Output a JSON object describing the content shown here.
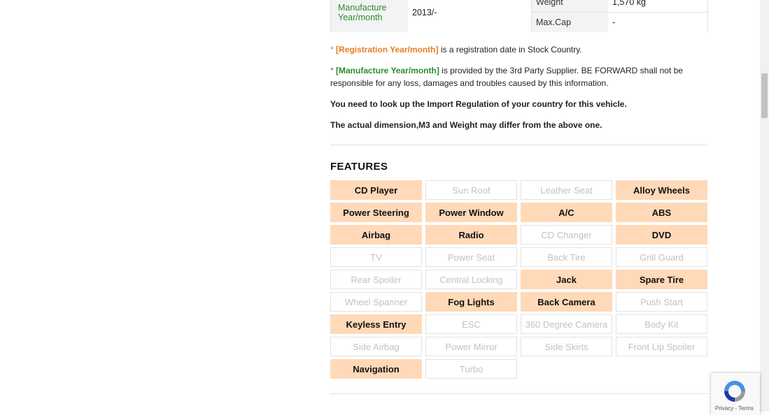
{
  "spec_table": {
    "manufacture_label": "Manufacture Year/month",
    "manufacture_value": "2013/-",
    "weight_label": "Weight",
    "weight_value": "1,570 kg",
    "maxcap_label": "Max.Cap",
    "maxcap_value": "-"
  },
  "notes": {
    "reg_star": "* ",
    "reg_label": "[Registration Year/month]",
    "reg_text": " is a registration date in Stock Country.",
    "man_star": "* ",
    "man_label": "[Manufacture Year/month]",
    "man_text": " is provided by the 3rd Party Supplier. BE FORWARD shall not be responsible for any loss, damages and troubles caused by this information.",
    "import_note": "You need to look up the Import Regulation of your country for this vehicle.",
    "dimension_note": "The actual dimension,M3 and Weight may differ from the above one."
  },
  "features": {
    "title": "FEATURES",
    "items": [
      {
        "label": "CD Player",
        "on": true
      },
      {
        "label": "Sun Roof",
        "on": false
      },
      {
        "label": "Leather Seat",
        "on": false
      },
      {
        "label": "Alloy Wheels",
        "on": true
      },
      {
        "label": "Power Steering",
        "on": true
      },
      {
        "label": "Power Window",
        "on": true
      },
      {
        "label": "A/C",
        "on": true
      },
      {
        "label": "ABS",
        "on": true
      },
      {
        "label": "Airbag",
        "on": true
      },
      {
        "label": "Radio",
        "on": true
      },
      {
        "label": "CD Changer",
        "on": false
      },
      {
        "label": "DVD",
        "on": true
      },
      {
        "label": "TV",
        "on": false
      },
      {
        "label": "Power Seat",
        "on": false
      },
      {
        "label": "Back Tire",
        "on": false
      },
      {
        "label": "Grill Guard",
        "on": false
      },
      {
        "label": "Rear Spoiler",
        "on": false
      },
      {
        "label": "Central Locking",
        "on": false
      },
      {
        "label": "Jack",
        "on": true
      },
      {
        "label": "Spare Tire",
        "on": true
      },
      {
        "label": "Wheel Spanner",
        "on": false
      },
      {
        "label": "Fog Lights",
        "on": true
      },
      {
        "label": "Back Camera",
        "on": true
      },
      {
        "label": "Push Start",
        "on": false
      },
      {
        "label": "Keyless Entry",
        "on": true
      },
      {
        "label": "ESC",
        "on": false
      },
      {
        "label": "360 Degree Camera",
        "on": false
      },
      {
        "label": "Body Kit",
        "on": false
      },
      {
        "label": "Side Airbag",
        "on": false
      },
      {
        "label": "Power Mirror",
        "on": false
      },
      {
        "label": "Side Skirts",
        "on": false
      },
      {
        "label": "Front Lip Spoiler",
        "on": false
      },
      {
        "label": "Navigation",
        "on": true
      },
      {
        "label": "Turbo",
        "on": false
      }
    ]
  },
  "recaptcha": {
    "links": "Privacy - Terms"
  },
  "colors": {
    "accent_orange": "#e67e22",
    "accent_green": "#2e8b2e",
    "feature_on_bg": "#ffd9b8"
  }
}
